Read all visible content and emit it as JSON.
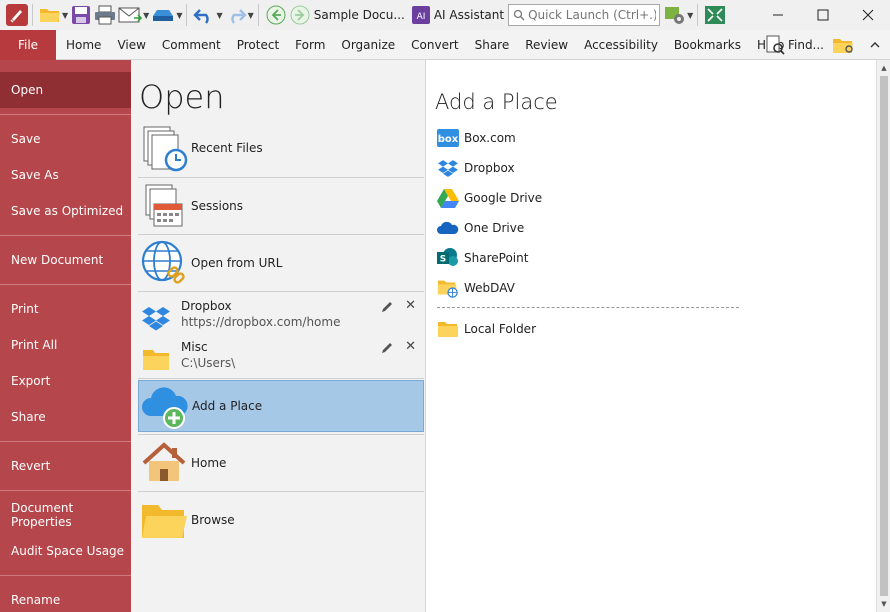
{
  "titlebar": {
    "document_tab": "Sample Docu...",
    "ai_assistant": "AI Assistant",
    "quick_launch_placeholder": "Quick Launch (Ctrl+.)"
  },
  "ribbon": {
    "tabs": [
      "File",
      "Home",
      "View",
      "Comment",
      "Protect",
      "Form",
      "Organize",
      "Convert",
      "Share",
      "Review",
      "Accessibility",
      "Bookmarks",
      "Help"
    ],
    "find_label": "Find..."
  },
  "file_menu": {
    "items": [
      "Open",
      "Save",
      "Save As",
      "Save as Optimized",
      "New Document",
      "Print",
      "Print All",
      "Export",
      "Share",
      "Revert",
      "Document Properties",
      "Audit Space Usage",
      "Rename"
    ],
    "active": "Open"
  },
  "open_panel": {
    "title": "Open",
    "recent_files": "Recent Files",
    "sessions": "Sessions",
    "open_from_url": "Open from URL",
    "places": [
      {
        "name": "Dropbox",
        "path": "https://dropbox.com/home"
      },
      {
        "name": "Misc",
        "path": "C:\\Users\\"
      }
    ],
    "add_place": "Add a Place",
    "home": "Home",
    "browse": "Browse"
  },
  "add_place_panel": {
    "title": "Add a Place",
    "services": [
      "Box.com",
      "Dropbox",
      "Google Drive",
      "One Drive",
      "SharePoint",
      "WebDAV"
    ],
    "local_folder": "Local Folder"
  },
  "colors": {
    "file_menu_bg": "#b5464b",
    "file_menu_active": "#8f2f33",
    "selected_item": "#a6c8e7"
  }
}
